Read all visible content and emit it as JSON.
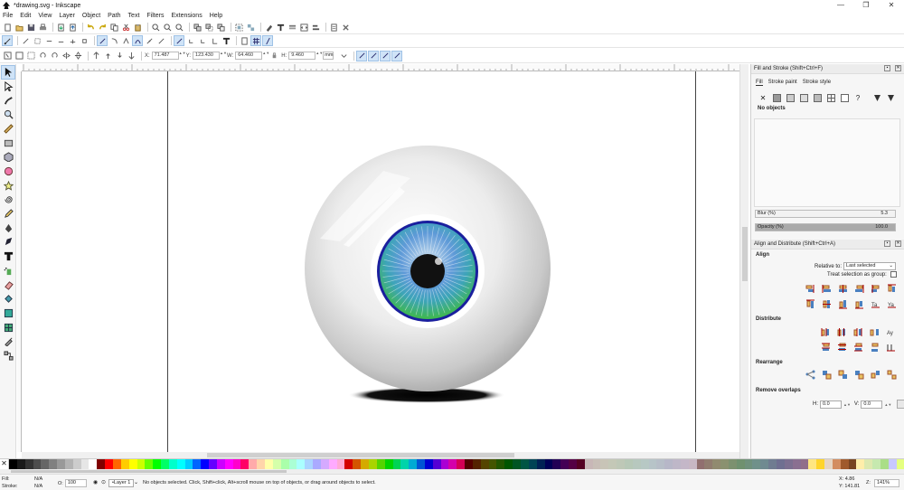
{
  "window": {
    "title": "*drawing.svg - Inkscape",
    "minimize": "—",
    "maximize": "❐",
    "close": "✕"
  },
  "menu": [
    "File",
    "Edit",
    "View",
    "Layer",
    "Object",
    "Path",
    "Text",
    "Filters",
    "Extensions",
    "Help"
  ],
  "controls": {
    "x_label": "X:",
    "x_value": "71.487",
    "y_label": "Y:",
    "y_value": "123.430",
    "w_label": "W:",
    "w_value": "64.460",
    "h_label": "H:",
    "h_value": "9.460",
    "unit": "mm"
  },
  "fill_stroke": {
    "title": "Fill and Stroke (Shift+Ctrl+F)",
    "tabs": [
      "Fill",
      "Stroke paint",
      "Stroke style"
    ],
    "no_objects": "No objects",
    "blur_label": "Blur (%)",
    "blur_value": "5.3",
    "opacity_label": "Opacity (%)",
    "opacity_value": "100.0"
  },
  "align": {
    "title": "Align and Distribute (Shift+Ctrl+A)",
    "align_label": "Align",
    "relative_label": "Relative to:",
    "relative_value": "Last selected",
    "treat_group": "Treat selection as group:",
    "distribute_label": "Distribute",
    "rearrange_label": "Rearrange",
    "remove_overlaps_label": "Remove overlaps",
    "h_label": "H:",
    "h_value": "0.0",
    "v_label": "V:",
    "v_value": "0.0"
  },
  "status": {
    "fill_label": "Fill:",
    "fill_value": "N/A",
    "stroke_label": "Stroke:",
    "stroke_value": "N/A",
    "opacity_label": "O:",
    "opacity_value": "100",
    "layer": "•Layer 1",
    "message": "No objects selected. Click, Shift+click, Alt+scroll mouse on top of objects, or drag around objects to select.",
    "x_coord": "X:  4.86",
    "y_coord": "Y: 141.81",
    "zoom_label": "Z:",
    "zoom": "141%"
  },
  "colors": {
    "iris_blue": "#3d6fd6",
    "iris_green": "#3fb84c",
    "iris_ring": "#1a1f9e",
    "pupil": "#111111"
  },
  "palette": [
    "#000000",
    "#1a1a1a",
    "#333333",
    "#4d4d4d",
    "#666666",
    "#808080",
    "#999999",
    "#b3b3b3",
    "#cccccc",
    "#e6e6e6",
    "#ffffff",
    "#800000",
    "#ff0000",
    "#ff6600",
    "#ffcc00",
    "#ffff00",
    "#ccff00",
    "#66ff00",
    "#00ff00",
    "#00ff66",
    "#00ffcc",
    "#00ffff",
    "#00ccff",
    "#0066ff",
    "#0000ff",
    "#6600ff",
    "#cc00ff",
    "#ff00ff",
    "#ff00cc",
    "#ff0066",
    "#ffaaaa",
    "#ffd5aa",
    "#ffffaa",
    "#d5ffaa",
    "#aaffaa",
    "#aaffd5",
    "#aaffff",
    "#aad5ff",
    "#aaaaff",
    "#d5aaff",
    "#ffaaff",
    "#ffaad5",
    "#d40000",
    "#d45500",
    "#d4aa00",
    "#aad400",
    "#55d400",
    "#00d400",
    "#00d455",
    "#00d4aa",
    "#00aad4",
    "#0055d4",
    "#0000d4",
    "#5500d4",
    "#aa00d4",
    "#d400aa",
    "#d40055",
    "#550000",
    "#552200",
    "#554400",
    "#445500",
    "#225500",
    "#005500",
    "#005522",
    "#005544",
    "#004455",
    "#002255",
    "#000055",
    "#220055",
    "#440055",
    "#550044",
    "#550022",
    "#c8b7b7",
    "#c8beb7",
    "#c8c4b7",
    "#c4c8b7",
    "#bec8b7",
    "#b7c8b7",
    "#b7c8be",
    "#b7c8c4",
    "#b7c4c8",
    "#b7bec8",
    "#b7b7c8",
    "#beb7c8",
    "#c4b7c8",
    "#c8b7c4",
    "#916f6f",
    "#917c6f",
    "#918a6f",
    "#8a916f",
    "#7c916f",
    "#6f916f",
    "#6f917c",
    "#6f918a",
    "#6f8a91",
    "#6f7c91",
    "#6f6f91",
    "#7c6f91",
    "#8a6f91",
    "#916f8a",
    "#ffe680",
    "#ffd42a",
    "#e6d5c2",
    "#d38d5f",
    "#a05a2c",
    "#784421",
    "#ffeeaa",
    "#dde9af",
    "#c6e9af",
    "#aade87",
    "#c8c8ff",
    "#e5ff80"
  ]
}
